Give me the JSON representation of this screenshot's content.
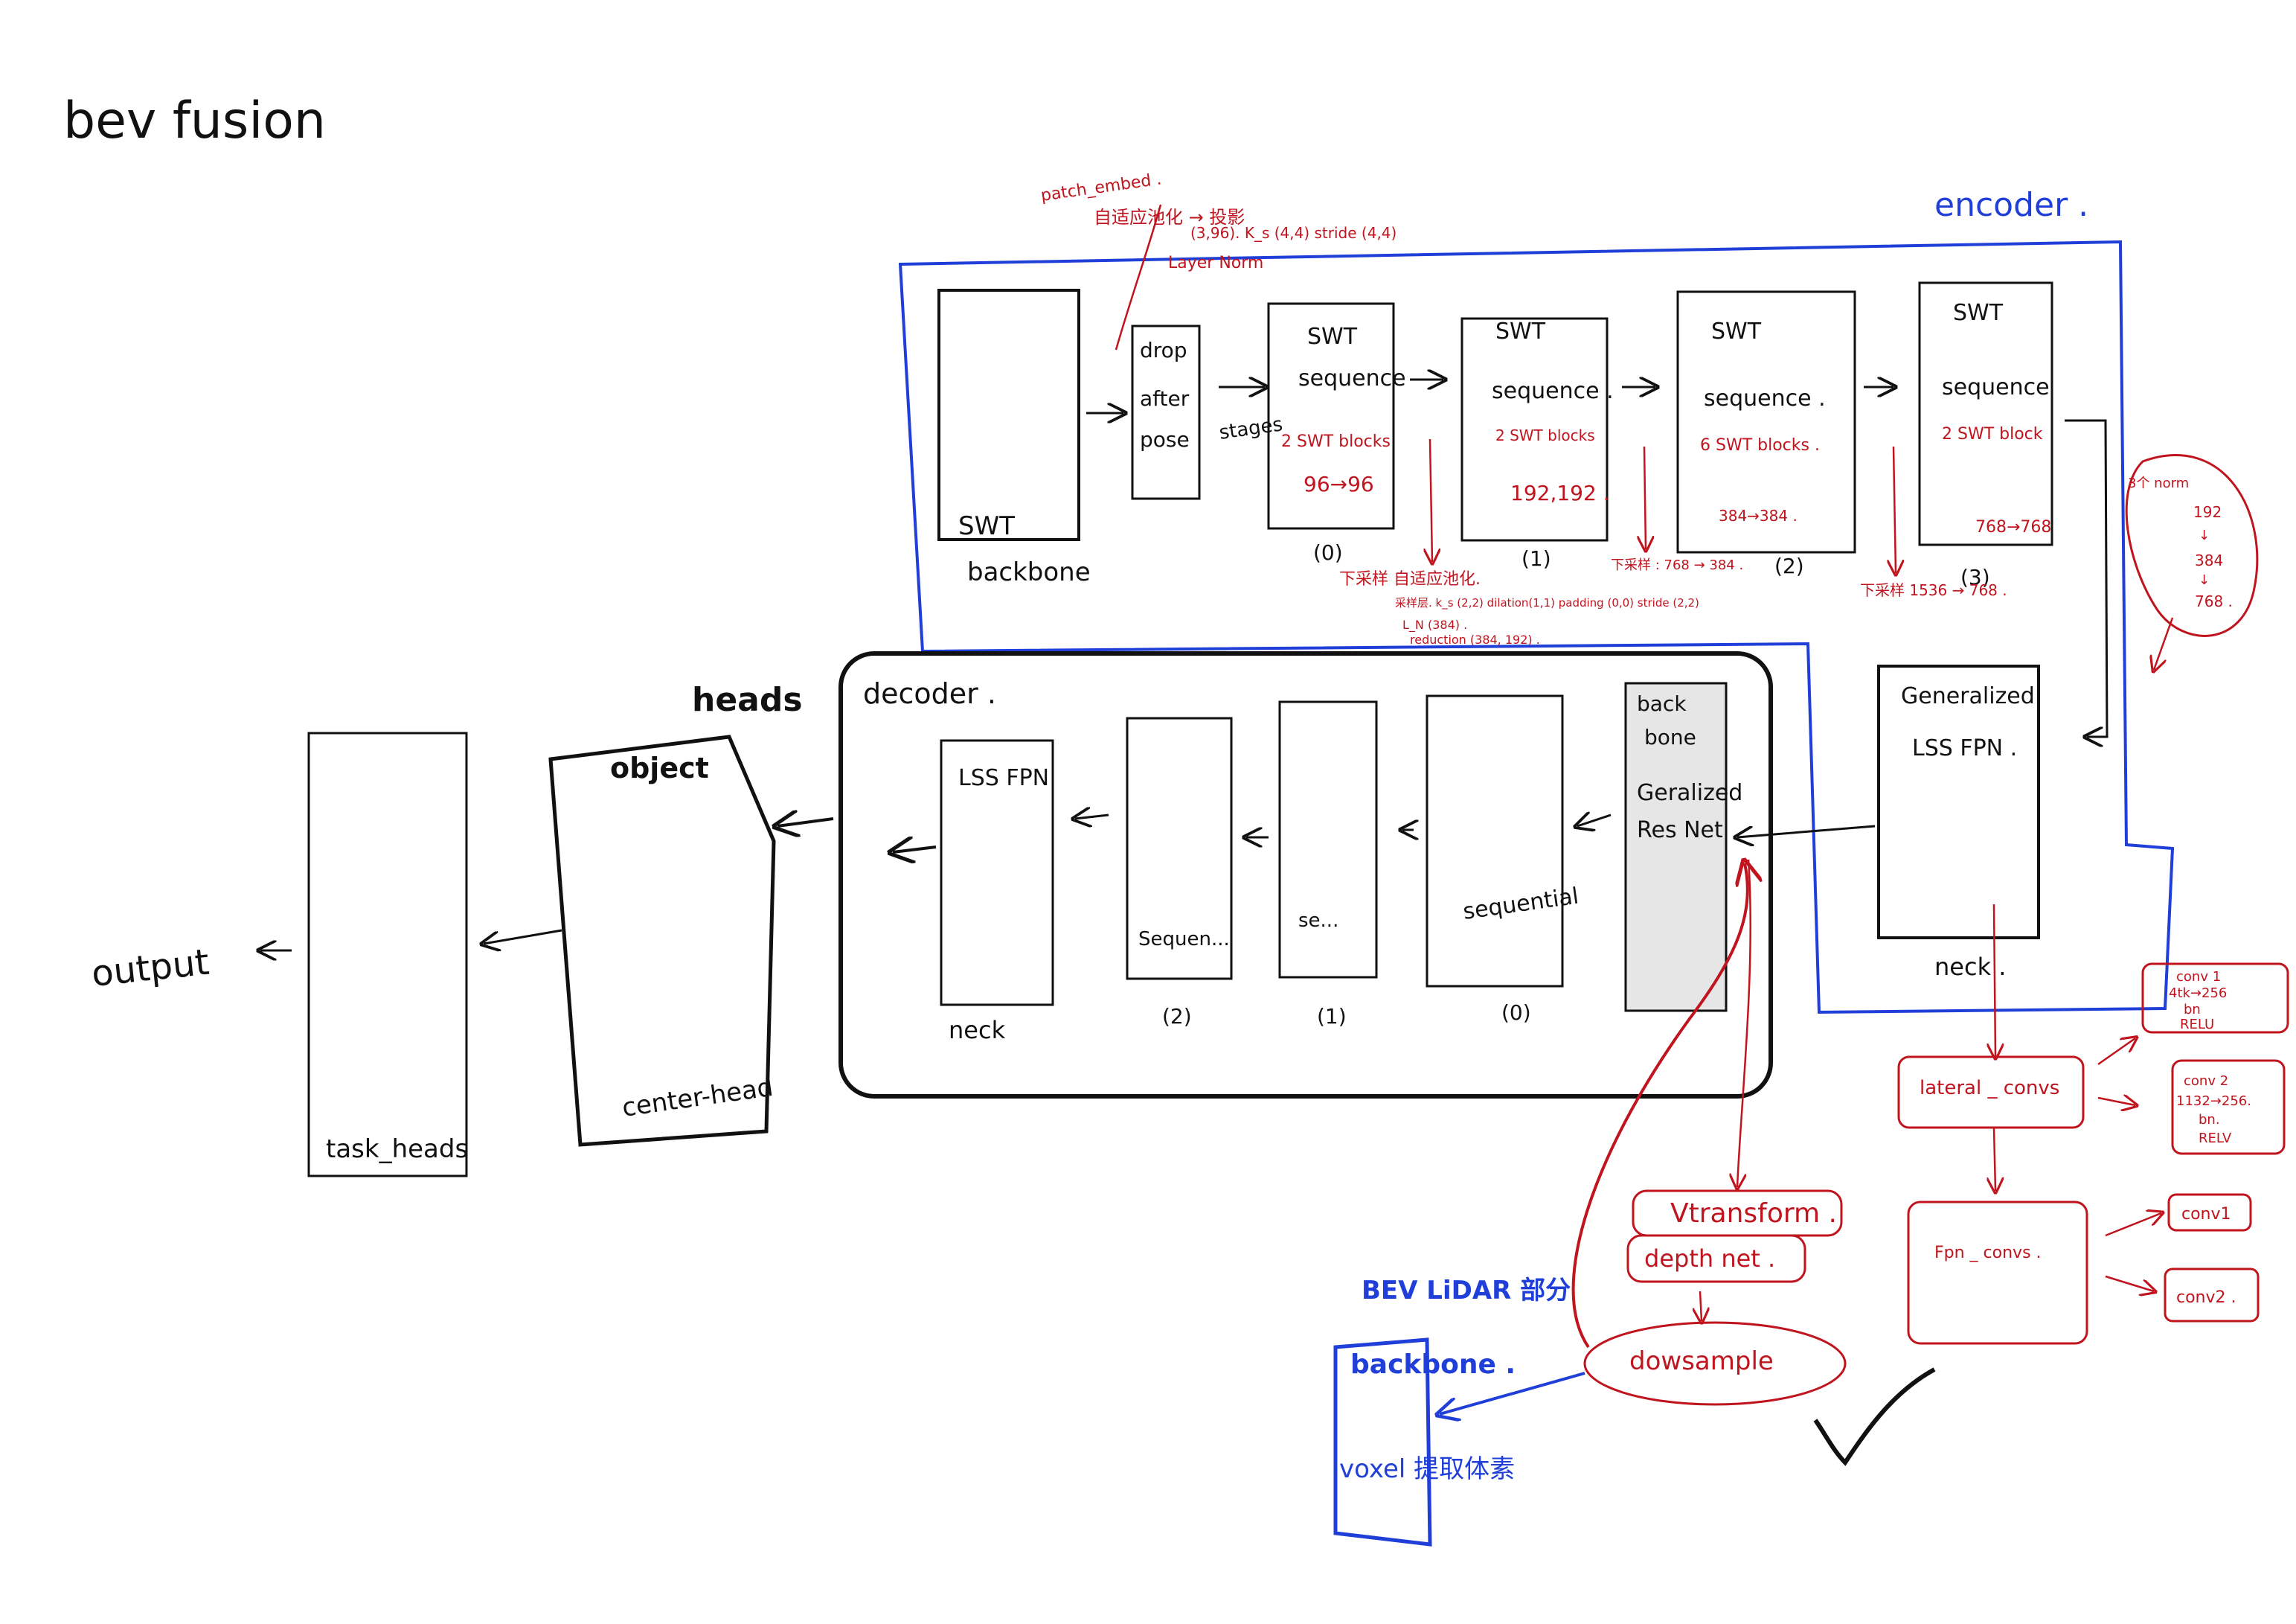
{
  "title": "bev fusion",
  "colors": {
    "ink": "#111111",
    "red": "#c0141e",
    "blue": "#1f3fd8",
    "gray_fill": "#e6e6e6"
  },
  "encoder": {
    "label": "encoder .",
    "backbone_block": {
      "inner": "SWT",
      "caption": "backbone"
    },
    "drop_block": {
      "line1": "drop",
      "line2": "after",
      "line3": "pose",
      "stages_label": "stages"
    },
    "stages": [
      {
        "l1": "SWT",
        "l2": "sequence",
        "l3": "2 SWT blocks",
        "l4": "96→96",
        "index": "(0)"
      },
      {
        "l1": "SWT",
        "l2": "sequence .",
        "l3": "2 SWT blocks",
        "l4": "192,192 .",
        "index": "(1)"
      },
      {
        "l1": "SWT",
        "l2": "sequence .",
        "l3": "6 SWT blocks .",
        "l4": "384→384 .",
        "index": "(2)"
      },
      {
        "l1": "SWT",
        "l2": "sequence",
        "l3": "2 SWT block",
        "l4": "768→768",
        "index": "(3)"
      }
    ],
    "neck_block": {
      "l1": "Generalized",
      "l2": "LSS FPN .",
      "caption": "neck ."
    },
    "patch_embed_notes": [
      "patch_embed .",
      "自适应池化 → 投影",
      "(3,96). K_s (4,4) stride (4,4)",
      "Layer Norm"
    ],
    "downsample_notes": [
      "下采样  自适应池化.",
      "采样层.  k_s (2,2)  dilation(1,1) padding (0,0)  stride (2,2)",
      "L_N (384) .",
      "reduction  (384, 192) ."
    ],
    "stage2_note": "下采样 : 768 → 384 .",
    "stage3_note": "下采样\n1536 → 768 .",
    "norm_notes": [
      "3个 norm",
      "192",
      "↓",
      "384",
      "↓",
      "768 ."
    ]
  },
  "decoder": {
    "label": "decoder .",
    "backbone_block": {
      "l1": "back",
      "l2": "bone",
      "l3": "Geralized",
      "l4": "Res Net"
    },
    "sequentials": [
      {
        "label": "sequential",
        "index": "(0)"
      },
      {
        "label": "se...",
        "index": "(1)"
      },
      {
        "label": "Sequen...",
        "index": "(2)"
      }
    ],
    "neck_block": {
      "label": "LSS FPN",
      "caption": "neck"
    }
  },
  "heads": {
    "label": "heads",
    "object_block": {
      "l1": "object",
      "l2": "center-head"
    },
    "task_block": {
      "label": "task_heads"
    }
  },
  "output_label": "output",
  "red_notes": {
    "lateral": "lateral _ convs",
    "conv1": [
      "conv 1",
      "4tk→256",
      "bn",
      "RELU"
    ],
    "conv2": [
      "conv 2",
      "1132→256.",
      "bn.",
      "RELV"
    ],
    "fpn": "Fpn _ convs .",
    "fpn_conv1": "conv1",
    "fpn_conv2": "conv2 .",
    "vtransform": "Vtransform .",
    "depth_net": "depth net .",
    "downsample": "dowsample"
  },
  "lidar": {
    "title": "BEV LiDAR 部分",
    "backbone": "backbone .",
    "voxel": "voxel 提取体素"
  }
}
